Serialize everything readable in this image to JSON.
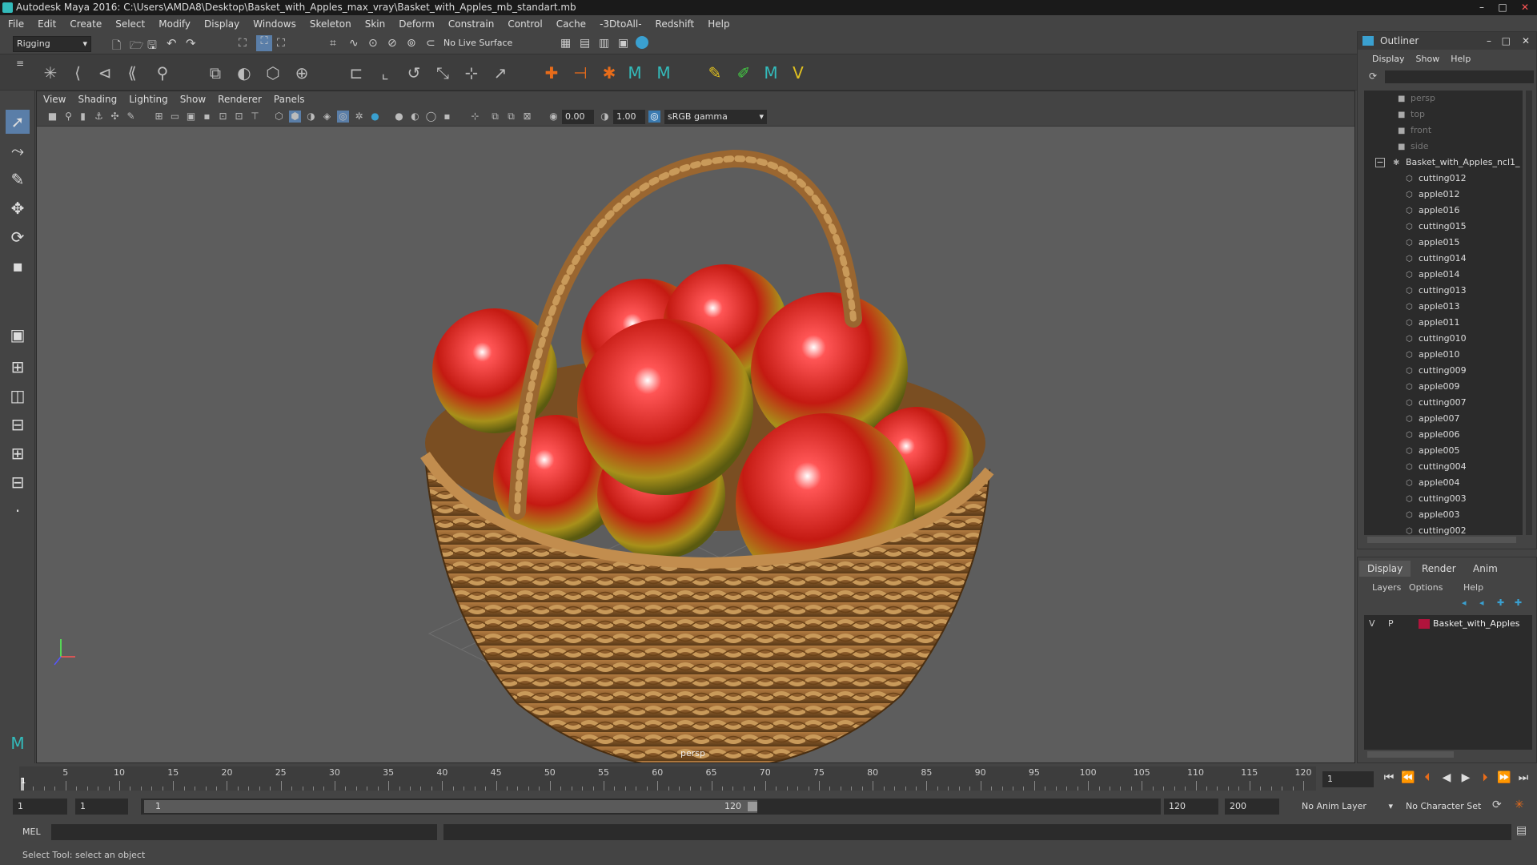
{
  "window": {
    "title": "Autodesk Maya 2016: C:\\Users\\AMDA8\\Desktop\\Basket_with_Apples_max_vray\\Basket_with_Apples_mb_standart.mb",
    "controls": [
      "–",
      "□",
      "✕"
    ]
  },
  "menubar": [
    "File",
    "Edit",
    "Create",
    "Select",
    "Modify",
    "Display",
    "Windows",
    "Skeleton",
    "Skin",
    "Deform",
    "Constrain",
    "Control",
    "Cache",
    "-3DtoAll-",
    "Redshift",
    "Help"
  ],
  "statusline": {
    "menuset": "Rigging",
    "live_surface": "No Live Surface"
  },
  "viewport": {
    "menu": [
      "View",
      "Shading",
      "Lighting",
      "Show",
      "Renderer",
      "Panels"
    ],
    "exposure": "0.00",
    "gamma": "1.00",
    "color_space": "sRGB gamma",
    "camera_label": "persp"
  },
  "outliner": {
    "title": "Outliner",
    "controls": [
      "–",
      "□",
      "✕"
    ],
    "menu": [
      "Display",
      "Show",
      "Help"
    ],
    "cameras": [
      "persp",
      "top",
      "front",
      "side"
    ],
    "group": "Basket_with_Apples_ncl1_",
    "children": [
      "cutting012",
      "apple012",
      "apple016",
      "cutting015",
      "apple015",
      "cutting014",
      "apple014",
      "cutting013",
      "apple013",
      "apple011",
      "cutting010",
      "apple010",
      "cutting009",
      "apple009",
      "cutting007",
      "apple007",
      "apple006",
      "apple005",
      "cutting004",
      "apple004",
      "cutting003",
      "apple003",
      "cutting002"
    ]
  },
  "layers": {
    "tabs": [
      "Display",
      "Render",
      "Anim"
    ],
    "menu": [
      "Layers",
      "Options",
      "Help"
    ],
    "layer": {
      "v": "V",
      "p": "P",
      "name": "Basket_with_Apples",
      "color": "#b0143c"
    }
  },
  "timeline": {
    "ticks": [
      "5",
      "10",
      "15",
      "20",
      "25",
      "30",
      "35",
      "40",
      "45",
      "50",
      "55",
      "60",
      "65",
      "70",
      "75",
      "80",
      "85",
      "90",
      "95",
      "100",
      "105",
      "110",
      "115",
      "120"
    ],
    "current_frame": "1",
    "start_marker": "1"
  },
  "range": {
    "start": "1",
    "playback_start": "1",
    "slider_start": "1",
    "slider_end": "120",
    "playback_end": "120",
    "end": "200",
    "anim_layer": "No Anim Layer",
    "character_set": "No Character Set"
  },
  "cmdline": {
    "label": "MEL"
  },
  "helpline": {
    "text": "Select Tool: select an object"
  },
  "colors": {
    "accent": "#4a8fd0",
    "layer_color": "#b0143c",
    "panel_bg": "#444444",
    "viewport_bg": "#5d5d5d"
  }
}
